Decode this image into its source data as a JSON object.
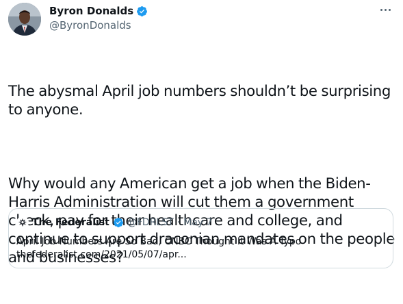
{
  "tweet": {
    "author": {
      "display_name": "Byron Donalds",
      "handle": "@ByronDonalds",
      "verified": true
    },
    "text_paragraphs": [
      "The abysmal April job numbers shouldn’t be surprising to anyone.",
      "Why would any American get a job when the Biden-Harris Administration will cut them a government check, pay for their healthcare and college, and continue to support draconian mandates on the people and businesses?"
    ],
    "quoted": {
      "display_name": "The Federalist",
      "handle": "@FDRLST",
      "separator": "·",
      "date": "May 7",
      "verified": true,
      "text": "April Job Numbers Are So Bad, CNBC Thought It Was A Typo",
      "link": "thefederalist.com/2021/05/07/apr..."
    }
  },
  "colors": {
    "text": "#0f1419",
    "muted": "#536471",
    "border": "#cfd9de",
    "verified": "#1d9bf0"
  },
  "icons": {
    "verified": "verified-badge-icon",
    "more": "more-options-icon"
  }
}
